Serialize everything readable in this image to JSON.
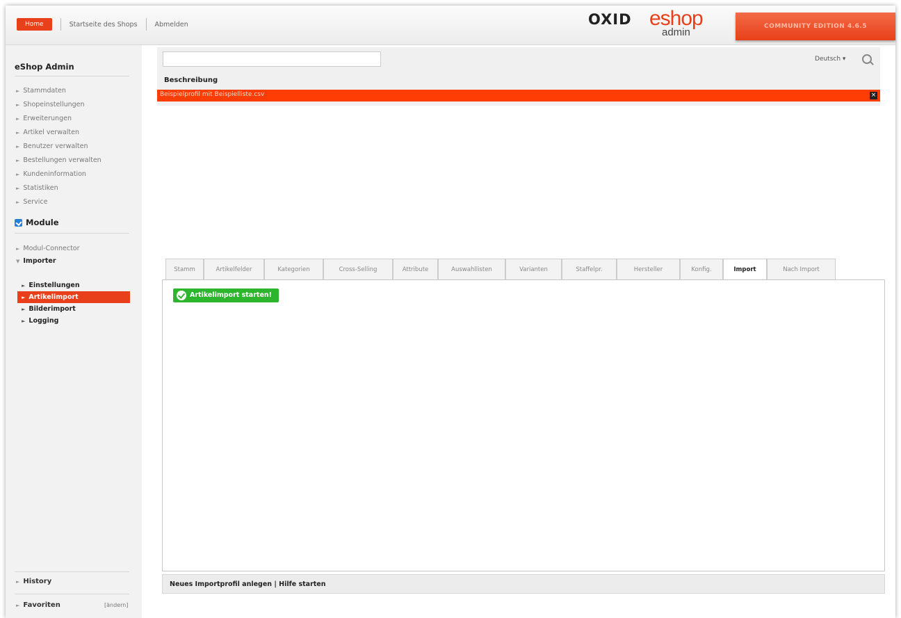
{
  "header": {
    "home_label": "Home",
    "shop_link": "Startseite des Shops",
    "logout_link": "Abmelden",
    "logo_oxid": "OXID",
    "logo_eshop": "eshop",
    "logo_admin": "admin",
    "edition": "COMMUNITY EDITION 4.6.5",
    "accent_color": "#e8401a"
  },
  "sidebar": {
    "title": "eShop Admin",
    "items": [
      {
        "label": "Stammdaten"
      },
      {
        "label": "Shopeinstellungen"
      },
      {
        "label": "Erweiterungen"
      },
      {
        "label": "Artikel verwalten"
      },
      {
        "label": "Benutzer verwalten"
      },
      {
        "label": "Bestellungen verwalten"
      },
      {
        "label": "Kundeninformation"
      },
      {
        "label": "Statistiken"
      },
      {
        "label": "Service"
      }
    ],
    "module_title": "Module",
    "module_items": [
      {
        "label": "Modul-Connector"
      },
      {
        "label": "Importer"
      }
    ],
    "importer_items": [
      {
        "label": "Einstellungen"
      },
      {
        "label": "Artikelimport"
      },
      {
        "label": "Bilderimport"
      },
      {
        "label": "Logging"
      }
    ],
    "history": "History",
    "favoriten": "Favoriten",
    "andern": "[ändern]"
  },
  "list": {
    "search_value": "",
    "language": "Deutsch",
    "column_header": "Beschreibung",
    "selected_profile": "Beispielprofil mit Beispielliste.csv"
  },
  "tabs": [
    "Stamm",
    "Artikelfelder",
    "Kategorien",
    "Cross-Selling",
    "Attribute",
    "Auswahllisten",
    "Varianten",
    "Staffelpr.",
    "Hersteller",
    "Konfig.",
    "Import",
    "Nach Import"
  ],
  "active_tab": "Import",
  "content": {
    "start_button": "Artikelimport starten!"
  },
  "footer": {
    "actions": "Neues Importprofil anlegen | Hilfe starten"
  }
}
